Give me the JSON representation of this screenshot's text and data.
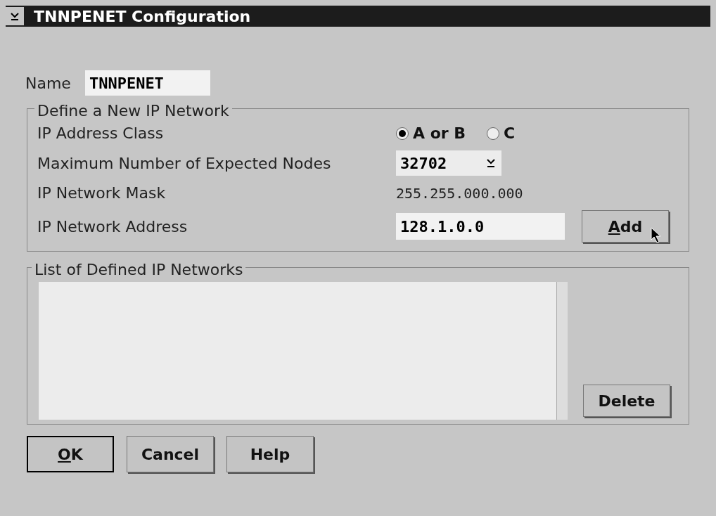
{
  "window": {
    "title": "TNNPENET Configuration"
  },
  "name_field": {
    "label": "Name",
    "value": "TNNPENET"
  },
  "define_group": {
    "title": "Define a New IP Network",
    "address_class": {
      "label": "IP Address Class",
      "options": [
        {
          "label": "A or B",
          "selected": true
        },
        {
          "label": "C",
          "selected": false
        }
      ]
    },
    "max_nodes": {
      "label": "Maximum Number of Expected Nodes",
      "value": "32702"
    },
    "mask": {
      "label": "IP Network Mask",
      "value": "255.255.000.000"
    },
    "address": {
      "label": "IP Network Address",
      "value": "128.1.0.0"
    },
    "add_button": {
      "label": "Add",
      "mnemonic": true
    }
  },
  "list_group": {
    "title": "List of Defined IP Networks",
    "delete_button": {
      "label": "Delete",
      "mnemonic": false
    }
  },
  "buttons": [
    {
      "label": "OK",
      "mnemonic": true,
      "default": true
    },
    {
      "label": "Cancel",
      "mnemonic": false,
      "default": false
    },
    {
      "label": "Help",
      "mnemonic": false,
      "default": false
    }
  ]
}
